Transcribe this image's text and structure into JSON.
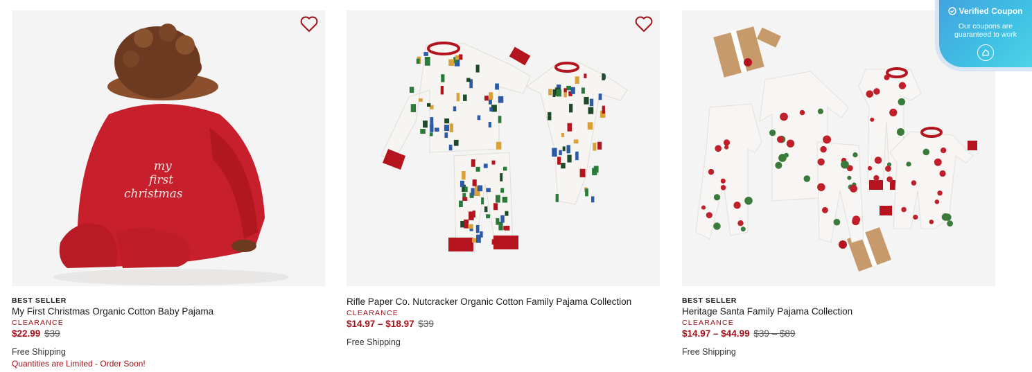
{
  "products": [
    {
      "badge": "BEST SELLER",
      "title": "My First Christmas Organic Cotton Baby Pajama",
      "clearance": "CLEARANCE",
      "price_now": "$22.99",
      "price_was": "$39",
      "shipping": "Free Shipping",
      "notice": "Quantities are Limited - Order Soon!",
      "image_text": [
        "my",
        "first",
        "christmas"
      ]
    },
    {
      "badge": "",
      "title": "Rifle Paper Co. Nutcracker Organic Cotton Family Pajama Collection",
      "clearance": "CLEARANCE",
      "price_now": "$14.97 – $18.97",
      "price_was": "$39",
      "shipping": "Free Shipping"
    },
    {
      "badge": "BEST SELLER",
      "title": "Heritage Santa Family Pajama Collection",
      "clearance": "CLEARANCE",
      "price_now": "$14.97 – $44.99",
      "price_was": "$39 – $89",
      "shipping": "Free Shipping"
    }
  ],
  "coupon": {
    "title": "Verified Coupon",
    "body": "Our coupons are guaranteed to work"
  },
  "icons": {
    "wishlist": "heart-outline-icon",
    "coupon_check": "check-circle-icon",
    "coupon_action": "coupon-logo-icon"
  },
  "colors": {
    "accent": "#a3101a",
    "heart": "#a3101a",
    "coupon": "#43b6e2"
  }
}
